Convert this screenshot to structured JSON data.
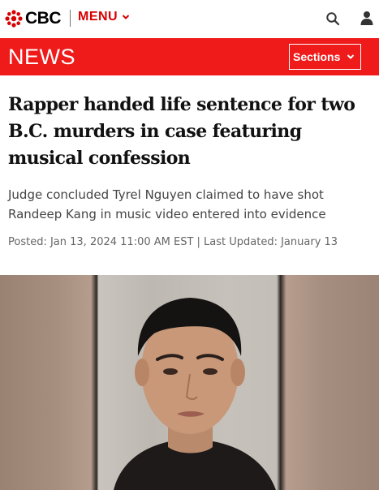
{
  "brand": {
    "name": "CBC",
    "logo_icon": "cbc-gem-logo",
    "accent": "#d80000"
  },
  "header": {
    "menu_label": "MENU",
    "search_icon": "search-icon",
    "user_icon": "user-icon"
  },
  "section_bar": {
    "title": "NEWS",
    "sections_label": "Sections",
    "bar_color": "#ef1b1b"
  },
  "article": {
    "headline": "Rapper handed life sentence for two B.C. murders in case featuring musical confession",
    "deck": "Judge concluded Tyrel Nguyen claimed to have shot Randeep Kang in music video entered into evidence",
    "byline": "Posted: Jan 13, 2024 11:00 AM EST | Last Updated: January 13"
  }
}
